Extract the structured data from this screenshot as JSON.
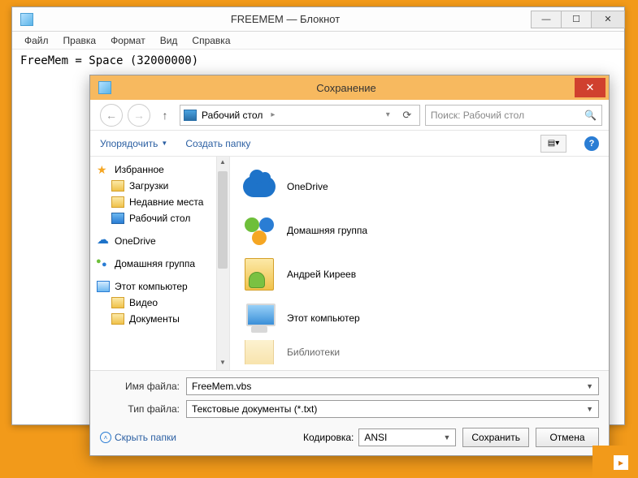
{
  "notepad": {
    "title": "FREEMEM — Блокнот",
    "menu": [
      "Файл",
      "Правка",
      "Формат",
      "Вид",
      "Справка"
    ],
    "content": "FreeMem = Space (32000000)"
  },
  "dialog": {
    "title": "Сохранение",
    "breadcrumb": "Рабочий стол",
    "search_placeholder": "Поиск: Рабочий стол",
    "toolbar": {
      "organize": "Упорядочить",
      "new_folder": "Создать папку"
    },
    "tree": {
      "favorites": "Избранное",
      "downloads": "Загрузки",
      "recent": "Недавние места",
      "desktop": "Рабочий стол",
      "onedrive": "OneDrive",
      "homegroup": "Домашняя группа",
      "this_pc": "Этот компьютер",
      "video": "Видео",
      "documents": "Документы"
    },
    "files": [
      {
        "name": "OneDrive",
        "icon": "onedrive"
      },
      {
        "name": "Домашняя группа",
        "icon": "homegroup"
      },
      {
        "name": "Андрей Киреев",
        "icon": "user"
      },
      {
        "name": "Этот компьютер",
        "icon": "computer"
      },
      {
        "name": "Библиотеки",
        "icon": "library"
      }
    ],
    "filename_label": "Имя файла:",
    "filename_value": "FreeMem.vbs",
    "filetype_label": "Тип файла:",
    "filetype_value": "Текстовые документы (*.txt)",
    "hide_folders": "Скрыть папки",
    "encoding_label": "Кодировка:",
    "encoding_value": "ANSI",
    "save": "Сохранить",
    "cancel": "Отмена"
  }
}
